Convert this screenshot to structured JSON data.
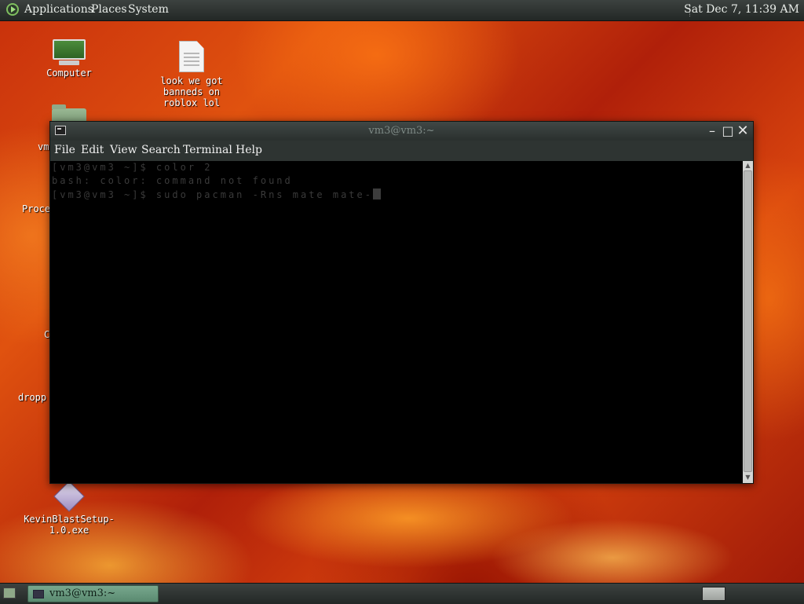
{
  "top_panel": {
    "menus": [
      "Applications",
      "Places",
      "System"
    ],
    "clock": "Sat Dec  7, 11:39 AM"
  },
  "desktop": {
    "icons": [
      {
        "label": "Computer"
      },
      {
        "label": "look we got\nbanneds on\nroblox lol"
      },
      {
        "label": "vm"
      },
      {
        "label": "Proce"
      },
      {
        "label": "C"
      },
      {
        "label": "dropp"
      },
      {
        "label": "KevinBlastSetup-\n1.0.exe"
      }
    ]
  },
  "terminal": {
    "title": "vm3@vm3:~",
    "menu": [
      "File",
      "Edit",
      "View",
      "Search",
      "Terminal",
      "Help"
    ],
    "lines": [
      "[vm3@vm3 ~]$ color 2",
      "bash: color: command not found",
      "[vm3@vm3 ~]$ sudo pacman -Rns mate mate-"
    ]
  },
  "taskbar": {
    "task_label": "vm3@vm3:~"
  }
}
